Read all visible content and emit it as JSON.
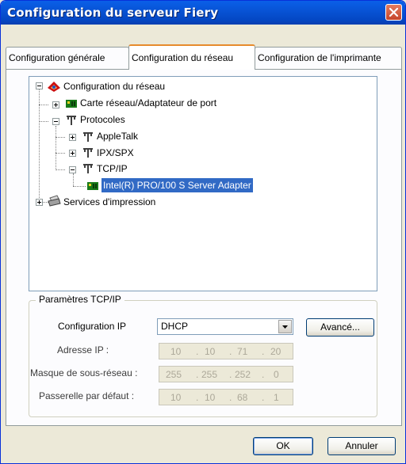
{
  "window": {
    "title": "Configuration du serveur Fiery"
  },
  "tabs": [
    {
      "label": "Configuration générale"
    },
    {
      "label": "Configuration du réseau"
    },
    {
      "label": "Configuration de l'imprimante"
    }
  ],
  "tree": {
    "root": "Configuration du réseau",
    "items": [
      {
        "label": "Carte réseau/Adaptateur de port"
      },
      {
        "label": "Protocoles"
      },
      {
        "label": "AppleTalk"
      },
      {
        "label": "IPX/SPX"
      },
      {
        "label": "TCP/IP"
      },
      {
        "label": "Intel(R) PRO/100 S Server Adapter"
      },
      {
        "label": "Services d'impression"
      }
    ]
  },
  "tcpip": {
    "group_label": "Paramètres TCP/IP",
    "config_label": "Configuration IP",
    "config_value": "DHCP",
    "advanced_label": "Avancé...",
    "ip_label": "Adresse IP :",
    "ip": [
      "10",
      "10",
      "71",
      "20"
    ],
    "mask_label": "Masque de sous-réseau :",
    "mask": [
      "255",
      "255",
      "252",
      "0"
    ],
    "gateway_label": "Passerelle par défaut :",
    "gateway": [
      "10",
      "10",
      "68",
      "1"
    ]
  },
  "footer": {
    "ok_label": "OK",
    "cancel_label": "Annuler"
  },
  "colors": {
    "titlebar": "#0854d6",
    "selection": "#316ac5",
    "close": "#c6452a"
  }
}
